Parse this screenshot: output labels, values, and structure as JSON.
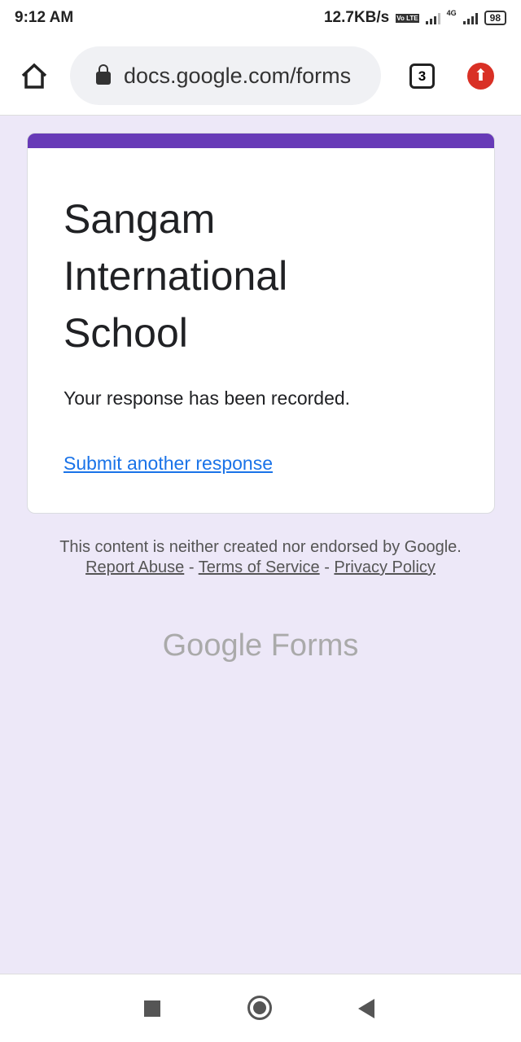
{
  "status": {
    "time": "9:12 AM",
    "speed": "12.7KB/s",
    "volte": "Vo LTE",
    "network": "4G",
    "battery": "98"
  },
  "browser": {
    "url": "docs.google.com/forms",
    "tab_count": "3"
  },
  "form": {
    "accent": "#673ab7",
    "title": "Sangam International School",
    "message": "Your response has been recorded.",
    "another_link": "Submit another response"
  },
  "footer": {
    "disclaimer": "This content is neither created nor endorsed by Google.",
    "report": "Report Abuse",
    "sep": " - ",
    "terms": "Terms of Service",
    "privacy": "Privacy Policy",
    "logo": "Google Forms"
  }
}
